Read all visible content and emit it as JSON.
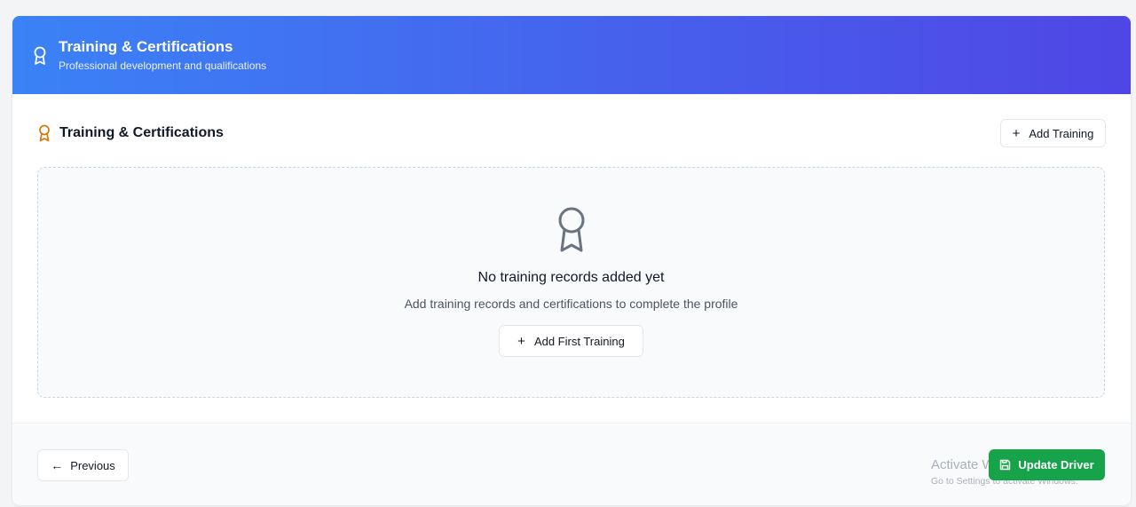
{
  "header": {
    "title": "Training & Certifications",
    "subtitle": "Professional development and qualifications",
    "icon": "award-icon"
  },
  "section": {
    "title": "Training & Certifications",
    "icon": "award-icon",
    "add_button_label": "Add Training"
  },
  "empty_state": {
    "icon": "award-icon",
    "title": "No training records added yet",
    "subtitle": "Add training records and certifications to complete the profile",
    "button_label": "Add First Training"
  },
  "footer": {
    "previous_label": "Previous",
    "update_label": "Update Driver"
  },
  "watermark": {
    "title": "Activate Windows",
    "subtitle": "Go to Settings to activate Windows."
  },
  "colors": {
    "header_gradient_start": "#3b82f6",
    "header_gradient_end": "#4f46e5",
    "section_icon": "#d97706",
    "update_button": "#16a34a"
  }
}
